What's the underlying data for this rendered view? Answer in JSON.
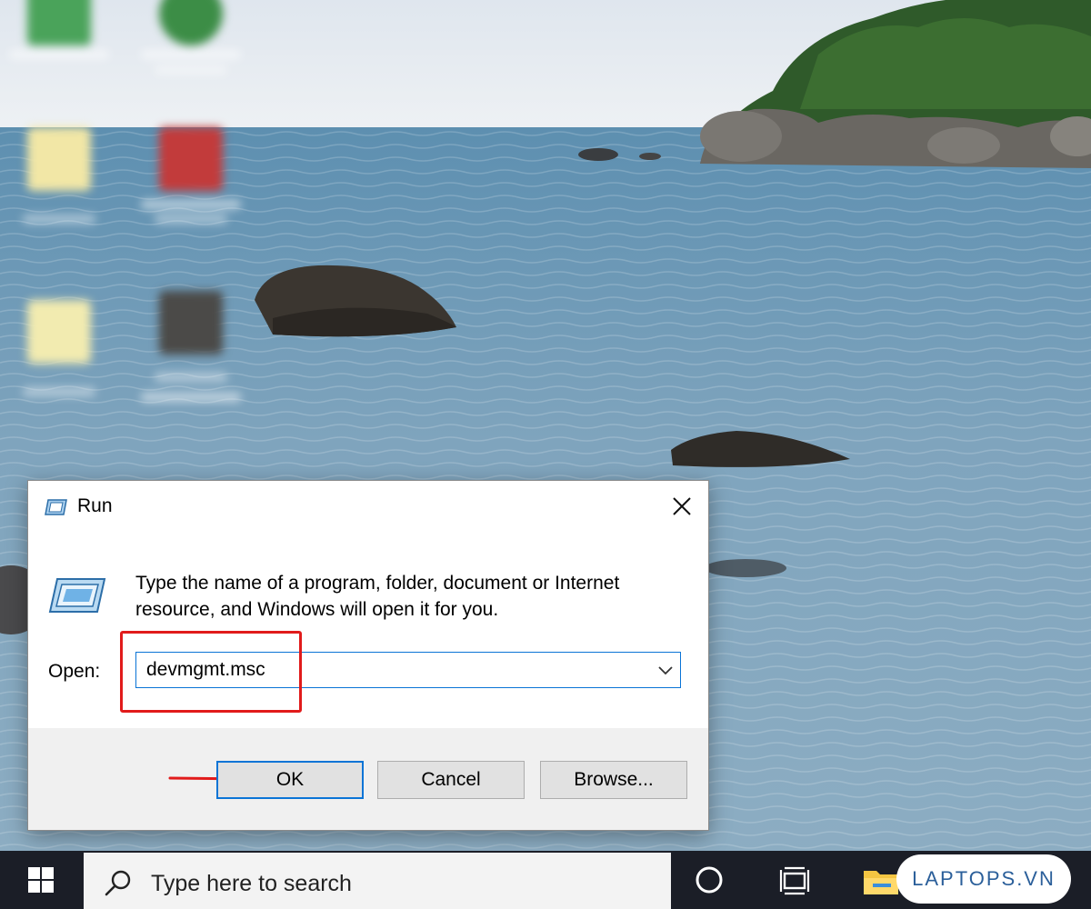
{
  "dialog": {
    "title": "Run",
    "description": "Type the name of a program, folder, document or Internet resource, and Windows will open it for you.",
    "open_label": "Open:",
    "open_value": "devmgmt.msc",
    "ok_label": "OK",
    "cancel_label": "Cancel",
    "browse_label": "Browse..."
  },
  "taskbar": {
    "search_placeholder": "Type here to search"
  },
  "watermark": "LAPTOPS.VN",
  "colors": {
    "focus_blue": "#0a74d6",
    "highlight_red": "#e11b1b",
    "taskbar": "#1b1e27",
    "dialog_footer": "#f0f0f0"
  },
  "icons": [
    "run-app-icon",
    "close-icon",
    "chevron-down-icon",
    "windows-logo-icon",
    "search-icon",
    "cortana-icon",
    "task-view-icon",
    "file-explorer-icon",
    "red-arrow-icon"
  ]
}
